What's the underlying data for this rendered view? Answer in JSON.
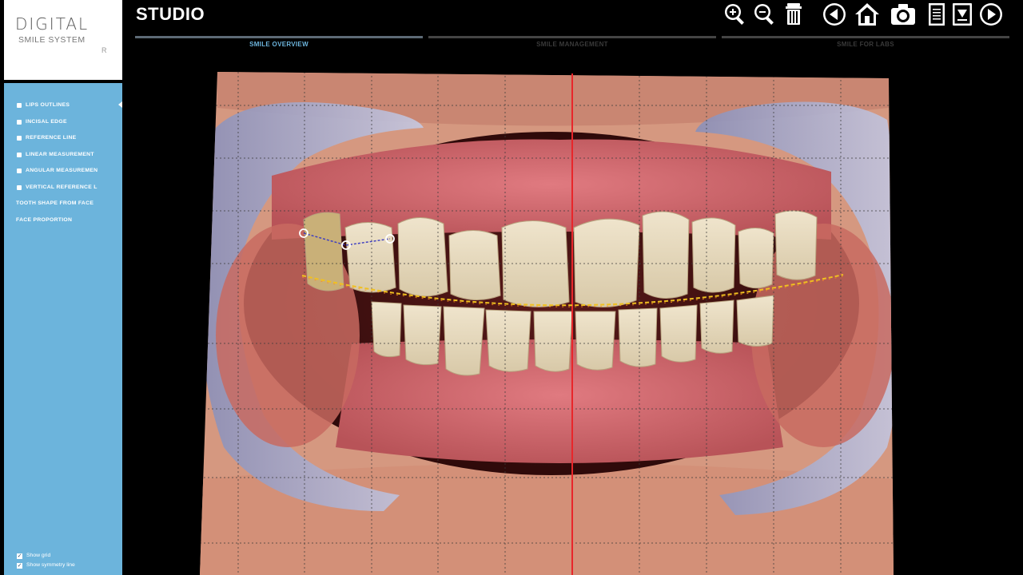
{
  "logo": {
    "line1": "DIGITAL",
    "line2": "SMILE SYSTEM",
    "line3": "R"
  },
  "header": {
    "title": "STUDIO"
  },
  "tabs": [
    {
      "label": "SMILE OVERVIEW",
      "active": true
    },
    {
      "label": "SMILE MANAGEMENT",
      "active": false
    },
    {
      "label": "SMILE FOR LABS",
      "active": false
    }
  ],
  "toolbar": {
    "icons": [
      "zoom-in-icon",
      "zoom-out-icon",
      "trash-icon",
      "back-icon",
      "home-icon",
      "camera-icon",
      "notes-icon",
      "download-icon",
      "forward-icon"
    ]
  },
  "sidebar": {
    "tools": [
      {
        "label": "LIPS OUTLINES",
        "checkbox": true,
        "selected": true
      },
      {
        "label": "INCISAL EDGE",
        "checkbox": true,
        "selected": false
      },
      {
        "label": "REFERENCE LINE",
        "checkbox": true,
        "selected": false
      },
      {
        "label": "LINEAR MEASUREMENT",
        "checkbox": true,
        "selected": false
      },
      {
        "label": "ANGULAR MEASUREMEN",
        "checkbox": true,
        "selected": false
      },
      {
        "label": "VERTICAL REFERENCE L",
        "checkbox": true,
        "selected": false
      },
      {
        "label": "TOOTH SHAPE FROM FACE",
        "checkbox": false,
        "selected": false
      },
      {
        "label": "FACE PROPORTION",
        "checkbox": false,
        "selected": false
      }
    ],
    "options": [
      {
        "label": "Show grid",
        "checked": true
      },
      {
        "label": "Show symmetry line",
        "checked": true
      }
    ]
  },
  "colors": {
    "sidebar": "#6cb4dc",
    "midline": "#e8262a",
    "incisal_curve": "#f0c020",
    "measure_line": "#4040c0",
    "grid": "#333333"
  }
}
